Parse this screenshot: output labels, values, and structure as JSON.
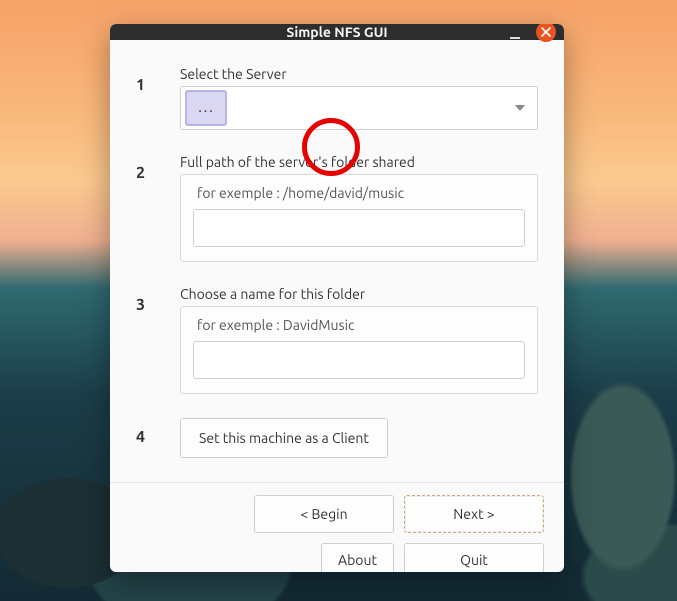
{
  "window": {
    "title": "Simple NFS GUI"
  },
  "steps": {
    "s1": {
      "num": "1",
      "label": "Select the Server",
      "browse_label": "..."
    },
    "s2": {
      "num": "2",
      "label": "Full path of the server's folder shared",
      "hint": "for exemple : /home/david/music",
      "value": ""
    },
    "s3": {
      "num": "3",
      "label": "Choose a name for this folder",
      "hint": "for exemple : DavidMusic",
      "value": ""
    },
    "s4": {
      "num": "4",
      "button": "Set this machine as a Client"
    }
  },
  "nav": {
    "begin": "< Begin",
    "next": "Next >",
    "about": "About",
    "quit": "Quit"
  },
  "colors": {
    "accent": "#e95420",
    "highlight": "#e60000"
  }
}
